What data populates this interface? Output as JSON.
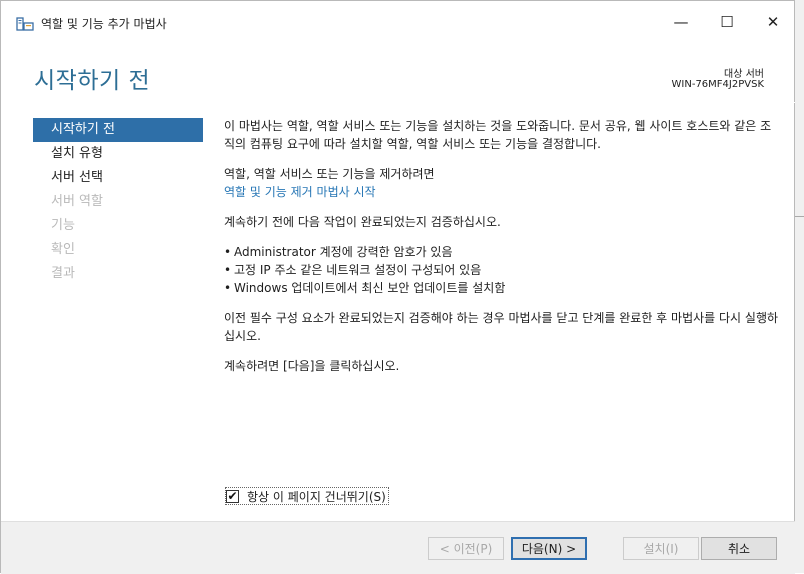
{
  "window": {
    "title": "역할 및 기능 추가 마법사",
    "controls": {
      "minimize": "—",
      "maximize": "☐",
      "close": "✕"
    }
  },
  "header": {
    "page_title": "시작하기 전",
    "target_label": "대상 서버",
    "target_server": "WIN-76MF4J2PVSK"
  },
  "nav": {
    "items": [
      {
        "label": "시작하기 전",
        "state": "active"
      },
      {
        "label": "설치 유형",
        "state": "enabled"
      },
      {
        "label": "서버 선택",
        "state": "enabled"
      },
      {
        "label": "서버 역할",
        "state": "disabled"
      },
      {
        "label": "기능",
        "state": "disabled"
      },
      {
        "label": "확인",
        "state": "disabled"
      },
      {
        "label": "결과",
        "state": "disabled"
      }
    ]
  },
  "content": {
    "intro": "이 마법사는 역할, 역할 서비스 또는 기능을 설치하는 것을 도와줍니다. 문서 공유, 웹 사이트 호스트와 같은 조직의 컴퓨팅 요구에 따라 설치할 역할, 역할 서비스 또는 기능을 결정합니다.",
    "remove_text": "역할, 역할 서비스 또는 기능을 제거하려면",
    "remove_link": "역할 및 기능 제거 마법사 시작",
    "verify_text": "계속하기 전에 다음 작업이 완료되었는지 검증하십시오.",
    "bullets": [
      "Administrator 계정에 강력한 암호가 있음",
      "고정 IP 주소 같은 네트워크 설정이 구성되어 있음",
      "Windows 업데이트에서 최신 보안 업데이트를 설치함"
    ],
    "prereq_text": "이전 필수 구성 요소가 완료되었는지 검증해야 하는 경우 마법사를 닫고 단계를 완료한 후 마법사를 다시 실행하십시오.",
    "continue_text": "계속하려면 [다음]을 클릭하십시오."
  },
  "skip_checkbox": {
    "label": "항상 이 페이지 건너뛰기(S)",
    "checked": true,
    "check_glyph": "✔"
  },
  "footer": {
    "prev": "< 이전(P)",
    "next": "다음(N) >",
    "install": "설치(I)",
    "cancel": "취소"
  },
  "colors": {
    "accent_orange": "#ea6a2c",
    "title_blue": "#2d6e95",
    "nav_active": "#2e6fa8",
    "link": "#2676b5"
  }
}
